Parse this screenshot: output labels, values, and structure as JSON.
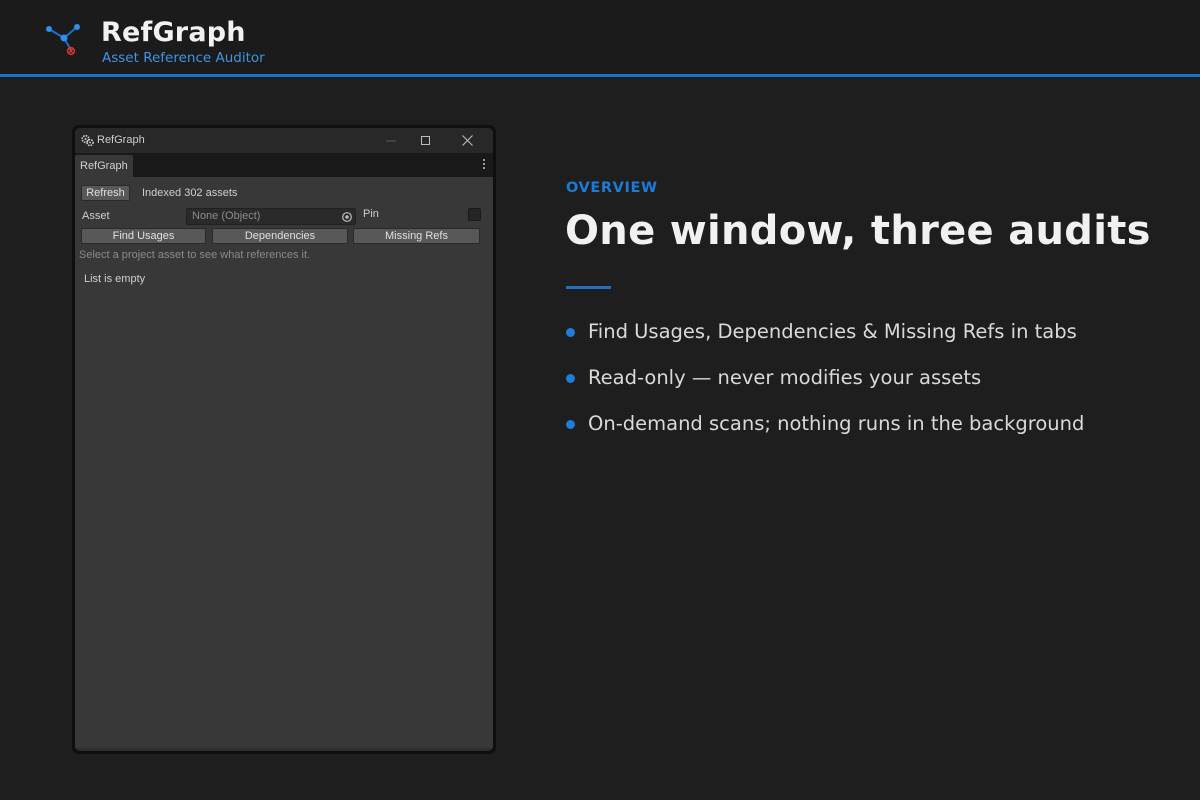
{
  "header": {
    "title": "RefGraph",
    "subtitle": "Asset Reference Auditor",
    "logo_icon": "node-graph-icon"
  },
  "editor_window": {
    "title": "RefGraph",
    "title_icon": "gear-cluster-icon",
    "tab_label": "RefGraph",
    "refresh_label": "Refresh",
    "index_status": "Indexed 302 assets",
    "asset_label": "Asset",
    "asset_value": "None (Object)",
    "pin_label": "Pin",
    "pin_checked": false,
    "audit_buttons": [
      "Find Usages",
      "Dependencies",
      "Missing Refs"
    ],
    "hint": "Select a project asset to see what references it.",
    "list_empty_text": "List is empty"
  },
  "overview": {
    "eyebrow": "OVERVIEW",
    "headline": "One window, three audits",
    "bullets": [
      "Find Usages, Dependencies & Missing Refs in tabs",
      "Read-only — never modifies your assets",
      "On-demand scans; nothing runs in the background"
    ]
  },
  "colors": {
    "accent": "#1d70c8",
    "accent_text": "#3f95e4",
    "background": "#1e1e1e",
    "window_bg": "#383838",
    "error_red": "#e0342f"
  }
}
